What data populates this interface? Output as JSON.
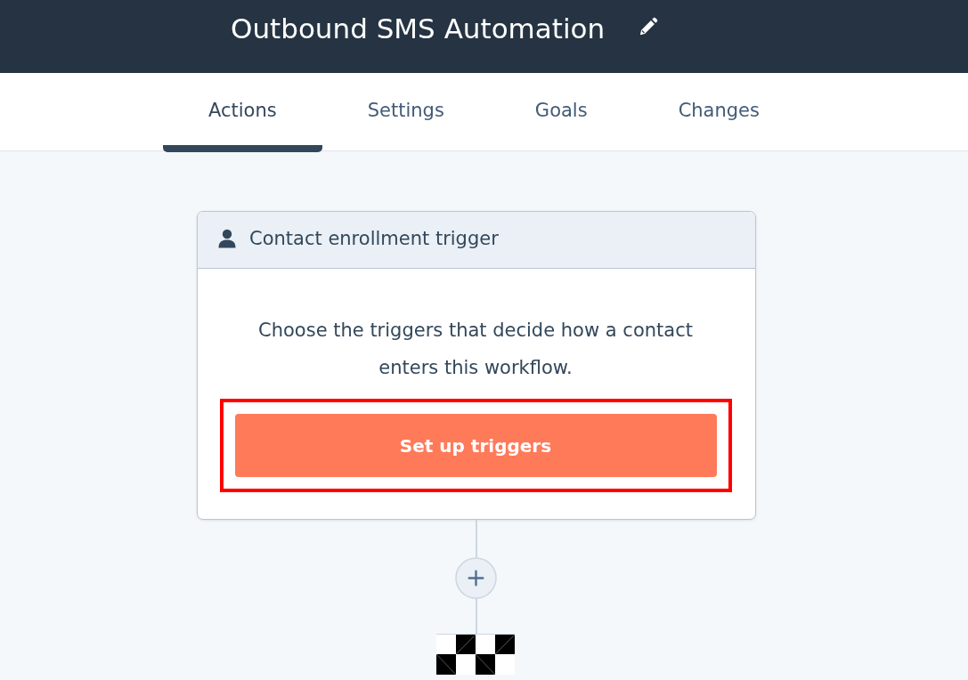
{
  "header": {
    "title": "Outbound SMS Automation"
  },
  "tabs": [
    {
      "label": "Actions",
      "selected": true
    },
    {
      "label": "Settings",
      "selected": false
    },
    {
      "label": "Goals",
      "selected": false
    },
    {
      "label": "Changes",
      "selected": false
    }
  ],
  "trigger_card": {
    "title": "Contact enrollment trigger",
    "description": "Choose the triggers that decide how a contact enters this workflow.",
    "button": {
      "label": "Set up triggers",
      "highlighted": true
    }
  }
}
